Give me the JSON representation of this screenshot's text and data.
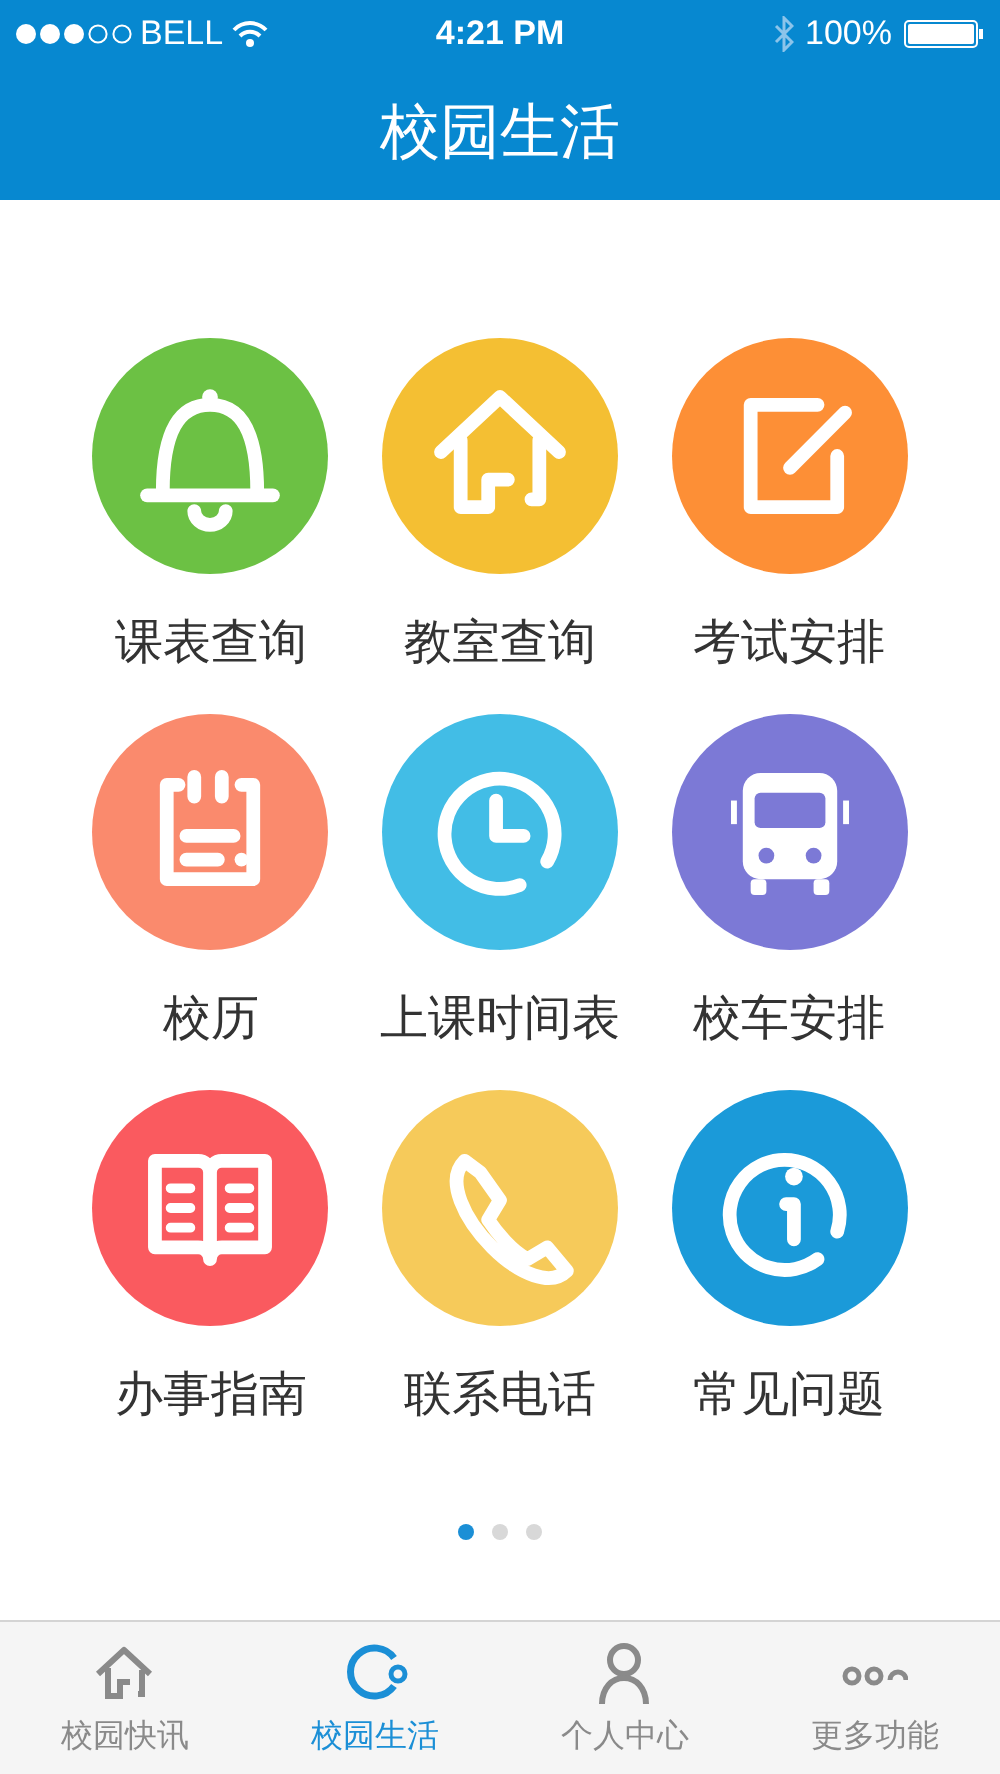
{
  "status_bar": {
    "carrier": "BELL",
    "time": "4:21 PM",
    "battery": "100%"
  },
  "nav": {
    "title": "校园生活"
  },
  "grid": [
    {
      "label": "课表查询",
      "color": "#6cc144"
    },
    {
      "label": "教室查询",
      "color": "#f4bf33"
    },
    {
      "label": "考试安排",
      "color": "#fd8f36"
    },
    {
      "label": "校历",
      "color": "#fa8a6d"
    },
    {
      "label": "上课时间表",
      "color": "#42bde6"
    },
    {
      "label": "校车安排",
      "color": "#7c79d6"
    },
    {
      "label": "办事指南",
      "color": "#fa5a5f"
    },
    {
      "label": "联系电话",
      "color": "#f6ca5a"
    },
    {
      "label": "常见问题",
      "color": "#1b9ad9"
    }
  ],
  "page_dots": [
    {
      "selected": true
    },
    {
      "selected": false
    },
    {
      "selected": false
    }
  ],
  "tabs": [
    {
      "label": "校园快讯",
      "selected": false
    },
    {
      "label": "校园生活",
      "selected": true
    },
    {
      "label": "个人中心",
      "selected": false
    },
    {
      "label": "更多功能",
      "selected": false
    }
  ]
}
